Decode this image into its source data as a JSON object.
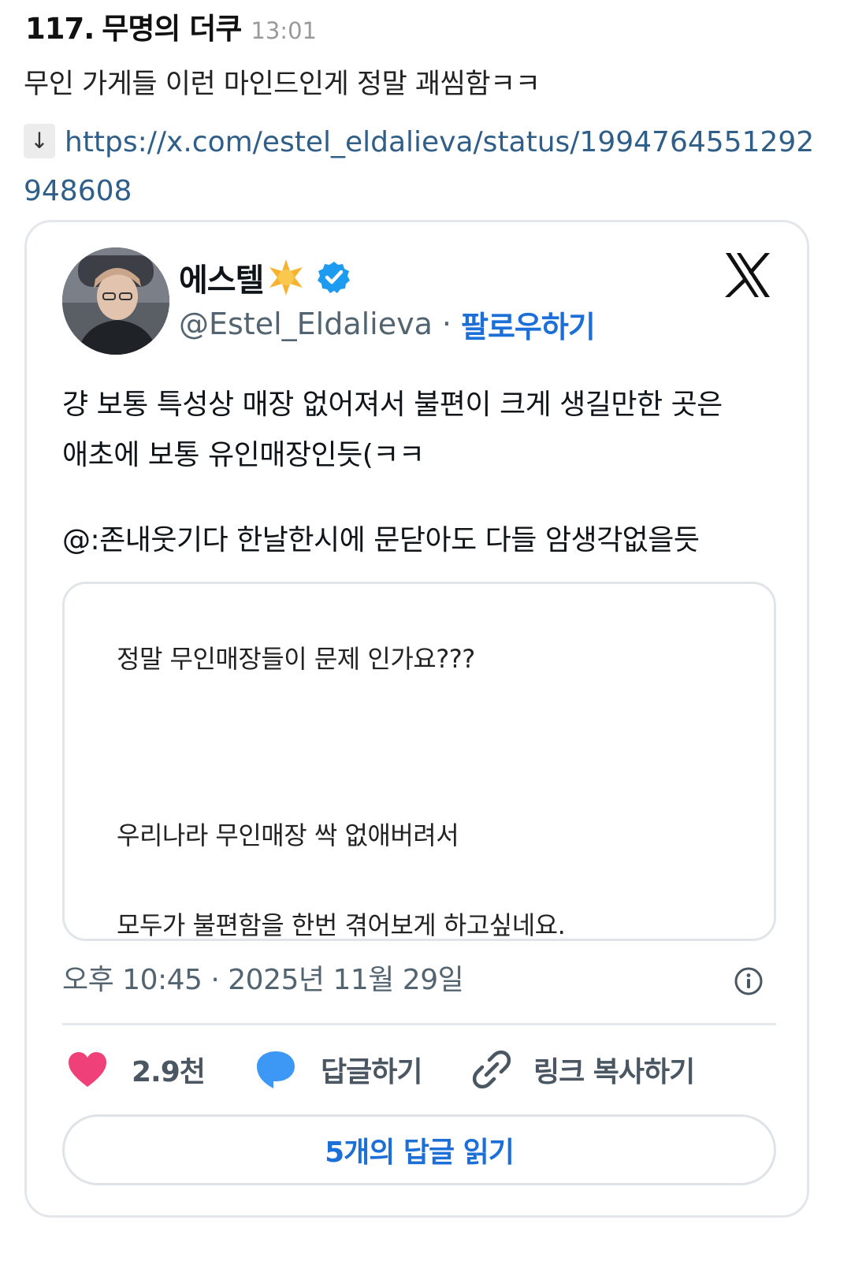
{
  "post": {
    "number": "117.",
    "author": "무명의 더쿠",
    "time": "13:01",
    "text": "무인 가게들 이런 마인드인게 정말 괘씸함ㅋㅋ",
    "link_arrow": "↓",
    "link_url": "https://x.com/estel_eldalieva/status/1994764551292948608"
  },
  "tweet": {
    "display_name": "에스텔",
    "handle": "@Estel_Eldalieva",
    "separator": "·",
    "follow_label": "팔로우하기",
    "body_lines": [
      "걍 보통 특성상 매장 없어져서 불편이 크게 생길만한 곳은",
      "애초에 보통 유인매장인듯(ㅋㅋ",
      "@:존내웃기다 한날한시에 문닫아도 다들 암생각없을듯"
    ],
    "quote_lines": [
      "정말 무인매장들이 문제 인가요???",
      "우리나라 무인매장 싹 없애버려서",
      "모두가 불편함을 한번 겪어보게 하고싶네요."
    ],
    "timestamp": "오후 10:45 · 2025년 11월 29일",
    "like_count": "2.9천",
    "reply_label": "답글하기",
    "copy_link_label": "링크 복사하기",
    "read_replies_label": "5개의 답글 읽기"
  },
  "colors": {
    "link": "#2f5e88",
    "accent_blue": "#1d6fd8",
    "like_pink": "#f0407a",
    "reply_blue": "#3d98f5",
    "verified_blue": "#1d9bf0",
    "star_gold": "#f5b330"
  },
  "icons": {
    "star": "star-badge-icon",
    "verified": "verified-badge-icon",
    "x_logo": "x-logo-icon",
    "info": "info-icon",
    "like": "heart-icon",
    "reply": "speech-bubble-icon",
    "copy_link": "link-icon"
  }
}
